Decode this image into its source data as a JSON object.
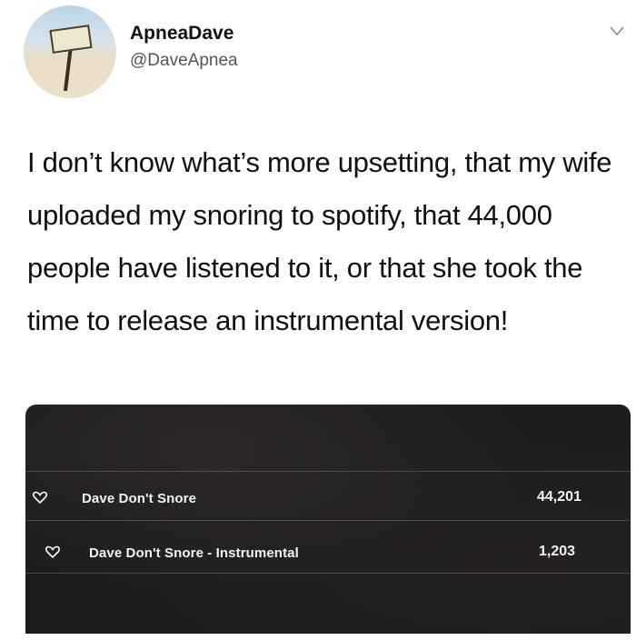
{
  "user": {
    "display_name": "ApneaDave",
    "handle": "@DaveApnea",
    "avatar_icon": "beach-sign-avatar",
    "menu_icon": "chevron-down-icon"
  },
  "tweet": {
    "text": "I don’t know what’s more upsetting, that my wife uploaded my snoring to spotify, that 44,000 people have listened to it, or that she took the time to release an instrumental version!"
  },
  "embedded_screenshot": {
    "tracks": [
      {
        "title": "Dave Don't Snore",
        "plays": "44,201",
        "icon": "heart-icon"
      },
      {
        "title": "Dave Don't Snore - Instrumental",
        "plays": "1,203",
        "icon": "heart-icon"
      }
    ]
  },
  "colors": {
    "text": "#111111",
    "handle": "#555555",
    "dark_panel": "#1e1c1c",
    "track_text": "#f2f2f2"
  }
}
